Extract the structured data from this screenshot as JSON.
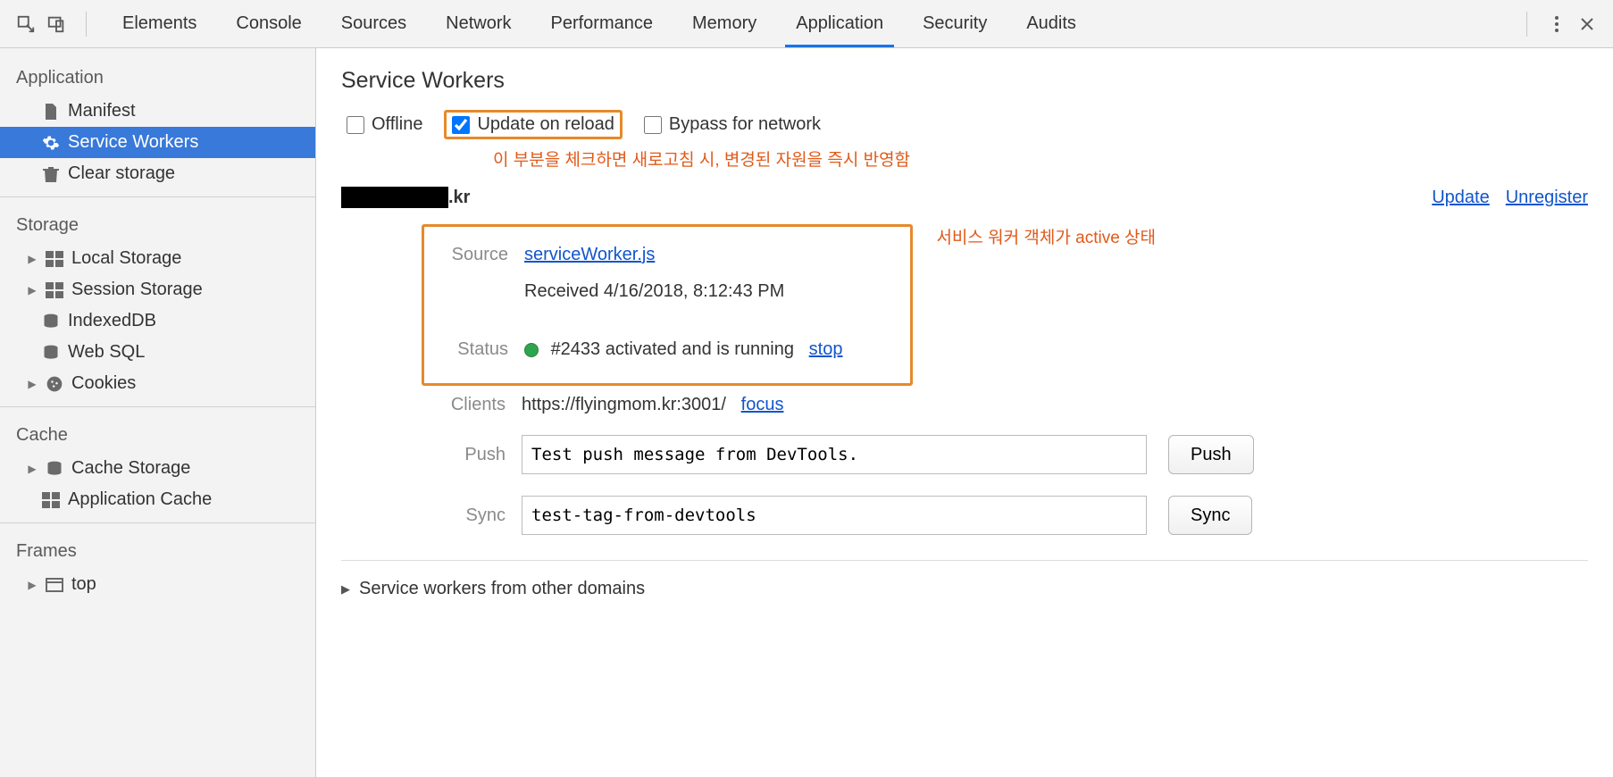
{
  "tabs": [
    "Elements",
    "Console",
    "Sources",
    "Network",
    "Performance",
    "Memory",
    "Application",
    "Security",
    "Audits"
  ],
  "active_tab": "Application",
  "sidebar": {
    "groups": [
      {
        "title": "Application",
        "items": [
          {
            "label": "Manifest",
            "icon": "file",
            "expand": false
          },
          {
            "label": "Service Workers",
            "icon": "gear",
            "expand": false,
            "selected": true
          },
          {
            "label": "Clear storage",
            "icon": "trash",
            "expand": false
          }
        ]
      },
      {
        "title": "Storage",
        "items": [
          {
            "label": "Local Storage",
            "icon": "grid4",
            "expand": true
          },
          {
            "label": "Session Storage",
            "icon": "grid4",
            "expand": true
          },
          {
            "label": "IndexedDB",
            "icon": "db",
            "expand": false
          },
          {
            "label": "Web SQL",
            "icon": "db",
            "expand": false
          },
          {
            "label": "Cookies",
            "icon": "cookie",
            "expand": true
          }
        ]
      },
      {
        "title": "Cache",
        "items": [
          {
            "label": "Cache Storage",
            "icon": "db",
            "expand": true
          },
          {
            "label": "Application Cache",
            "icon": "grid4",
            "expand": false
          }
        ]
      },
      {
        "title": "Frames",
        "items": [
          {
            "label": "top",
            "icon": "window",
            "expand": true
          }
        ]
      }
    ]
  },
  "main": {
    "title": "Service Workers",
    "checkboxes": {
      "offline": {
        "label": "Offline",
        "checked": false
      },
      "update_on_reload": {
        "label": "Update on reload",
        "checked": true
      },
      "bypass_for_network": {
        "label": "Bypass for network",
        "checked": false
      }
    },
    "annotation1": "이 부분을 체크하면 새로고침 시, 변경된 자원을 즉시 반영함",
    "annotation2": "서비스 워커 객체가 active 상태",
    "origin_suffix": ".kr",
    "actions": {
      "update": "Update",
      "unregister": "Unregister"
    },
    "detail": {
      "source_label": "Source",
      "source_link": "serviceWorker.js",
      "received": "Received 4/16/2018, 8:12:43 PM",
      "status_label": "Status",
      "status_text": "#2433 activated and is running",
      "stop": "stop",
      "clients_label": "Clients",
      "clients_url": "https://flyingmom.kr:3001/",
      "focus": "focus",
      "push_label": "Push",
      "push_value": "Test push message from DevTools.",
      "push_button": "Push",
      "sync_label": "Sync",
      "sync_value": "test-tag-from-devtools",
      "sync_button": "Sync"
    },
    "other_domains": "Service workers from other domains"
  }
}
